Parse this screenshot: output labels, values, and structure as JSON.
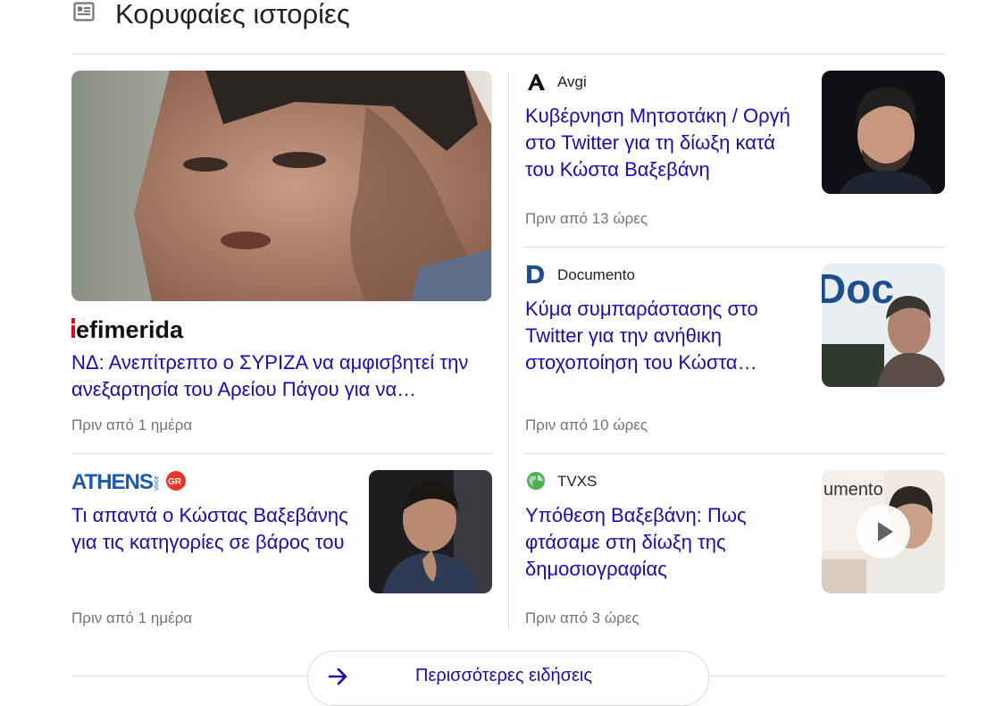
{
  "section": {
    "title": "Κορυφαίες ιστορίες",
    "icon": "newspaper-icon"
  },
  "stories": {
    "main": {
      "source": "iefimerida",
      "headline": "ΝΔ: Ανεπίτρεπτο ο ΣΥΡΙΖΑ να αμφισβητεί την ανεξαρτησία του Αρείου Πάγου για να…",
      "time": "Πριν από 1 ημέρα"
    },
    "athens": {
      "source": "ATHENS",
      "source_badge": "GR",
      "source_vertical": "voice",
      "headline": "Τι απαντά ο Κώστας Βαξεβάνης για τις κατηγορίες σε βάρος του",
      "time": "Πριν από 1 ημέρα"
    },
    "avgi": {
      "source": "Avgi",
      "headline": "Κυβέρνηση Μητσοτάκη / Οργή στο Twitter για τη δίωξη κατά του Κώστα Βαξεβάνη",
      "time": "Πριν από 13 ώρες"
    },
    "documento": {
      "source": "Documento",
      "headline": "Κύμα συμπαράστασης στο Twitter για την ανήθικη στοχοποίηση του Κώστα…",
      "time": "Πριν από 10 ώρες",
      "image_text": "Doc"
    },
    "tvxs": {
      "source": "TVXS",
      "headline": "Υπόθεση Βαξεβάνη: Πως φτάσαμε στη δίωξη της δημοσιογραφίας",
      "time": "Πριν από 3 ώρες",
      "image_text": "umento"
    }
  },
  "more_button": {
    "label": "Περισσότερες ειδήσεις"
  },
  "colors": {
    "link": "#1a0dab",
    "meta": "#70757a",
    "divider": "#dadce0",
    "iefimerida_red": "#e3001b",
    "athens_blue": "#1e5aa8"
  }
}
